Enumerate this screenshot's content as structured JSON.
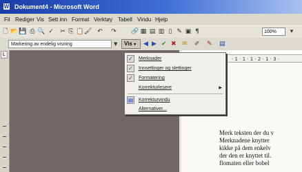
{
  "window": {
    "title": "Dokument4 - Microsoft Word",
    "app_icon": "word-icon"
  },
  "menubar": [
    "Fil",
    "Rediger",
    "Vis",
    "Sett inn",
    "Format",
    "Verktøy",
    "Tabell",
    "Vindu",
    "Hjelp"
  ],
  "toolbar": {
    "zoom": "100%"
  },
  "format_bar": {
    "style_value": "Markering av endelig visning",
    "show_button": "Vis"
  },
  "ruler": {
    "marks": "· 1 · 1 · 1 · 2 · 1 · 3 ·"
  },
  "menu": {
    "items": [
      {
        "label": "Merknader",
        "checked": true
      },
      {
        "label": "Innsettinger og slettinger",
        "checked": true
      },
      {
        "label": "Formatering",
        "checked": true
      },
      {
        "label": "Korrekturlesere",
        "submenu": true
      },
      {
        "label": "Korrekturvindu",
        "icon": "review-pane-icon"
      },
      {
        "label": "Alternativer..."
      }
    ]
  },
  "document": {
    "lines": [
      "Merk teksten der du v",
      "Merknadene knytter",
      "kikke på dem enkelv",
      "der den er knyttet til.",
      "flomaten eller bobel"
    ]
  }
}
